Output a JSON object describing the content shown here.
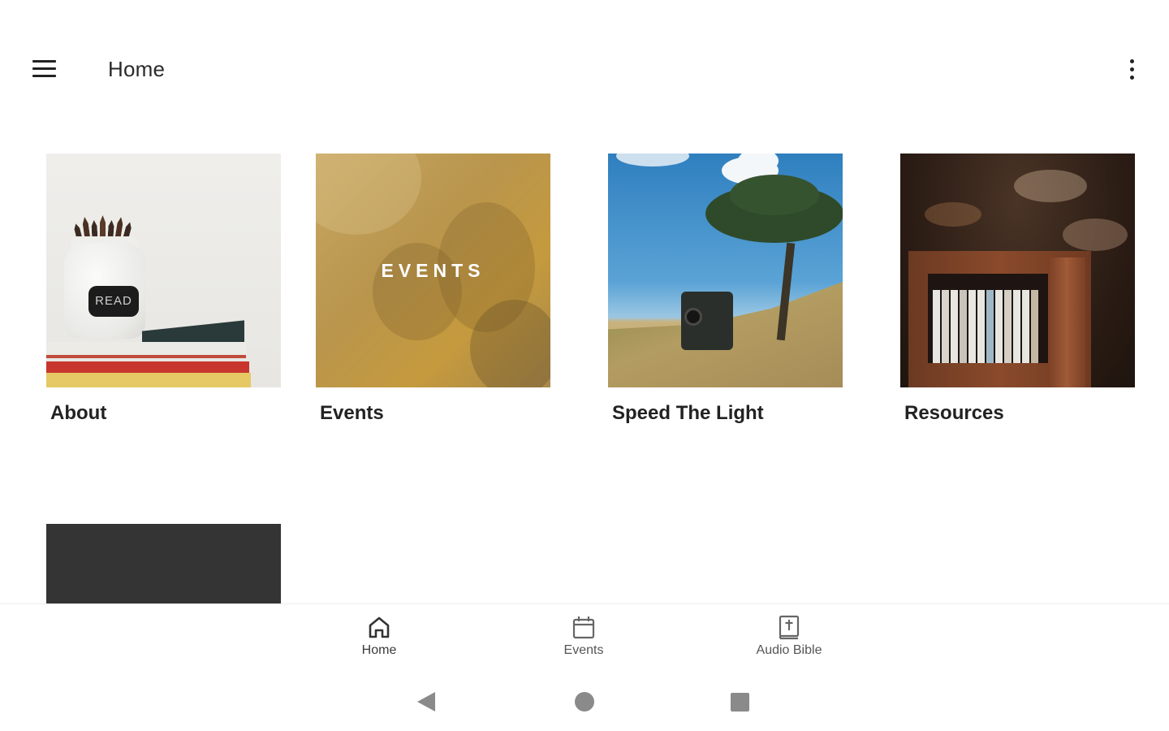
{
  "app_bar": {
    "title": "Home",
    "menu_icon": "hamburger-menu-icon",
    "overflow_icon": "more-vertical-icon"
  },
  "tiles": [
    {
      "label": "About"
    },
    {
      "label": "Events",
      "overlay_text": "EVENTS"
    },
    {
      "label": "Speed The Light"
    },
    {
      "label": "Resources"
    }
  ],
  "jar_label": "READ",
  "bottom_nav": {
    "items": [
      {
        "label": "Home",
        "icon": "home-icon",
        "active": true
      },
      {
        "label": "Events",
        "icon": "calendar-icon",
        "active": false
      },
      {
        "label": "Audio Bible",
        "icon": "bible-icon",
        "active": false
      }
    ]
  },
  "system_nav": {
    "back_icon": "back-triangle-icon",
    "home_icon": "home-circle-icon",
    "recents_icon": "recents-square-icon"
  },
  "colors": {
    "background": "#ffffff",
    "text_primary": "#222222",
    "nav_icon": "#555555",
    "system_nav": "#8a8a8a",
    "events_tint": "#c19a4c"
  }
}
